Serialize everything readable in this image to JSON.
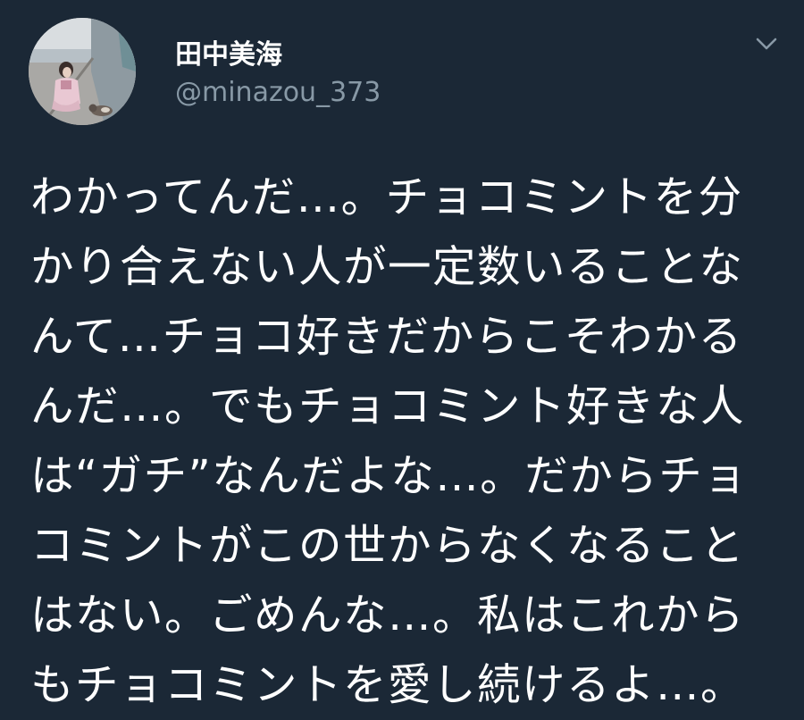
{
  "tweet": {
    "author": {
      "display_name": "田中美海",
      "handle": "@minazou_373"
    },
    "icons": {
      "menu": "chevron-down-icon",
      "avatar": "profile-photo"
    },
    "colors": {
      "background": "#1b2836",
      "text": "#ffffff",
      "secondary_text": "#8899a6"
    },
    "text_lines": [
      "わかってんだ…。チョコミントを分",
      "かり合えない人が一定数いることな",
      "んて…チョコ好きだからこそわかる",
      "んだ…。でもチョコミント好きな人",
      "は“ガチ”なんだよな…。だからチョ",
      "コミントがこの世からなくなること",
      "はない。ごめんな…。私はこれから",
      "もチョコミントを愛し続けるよ…。"
    ]
  }
}
